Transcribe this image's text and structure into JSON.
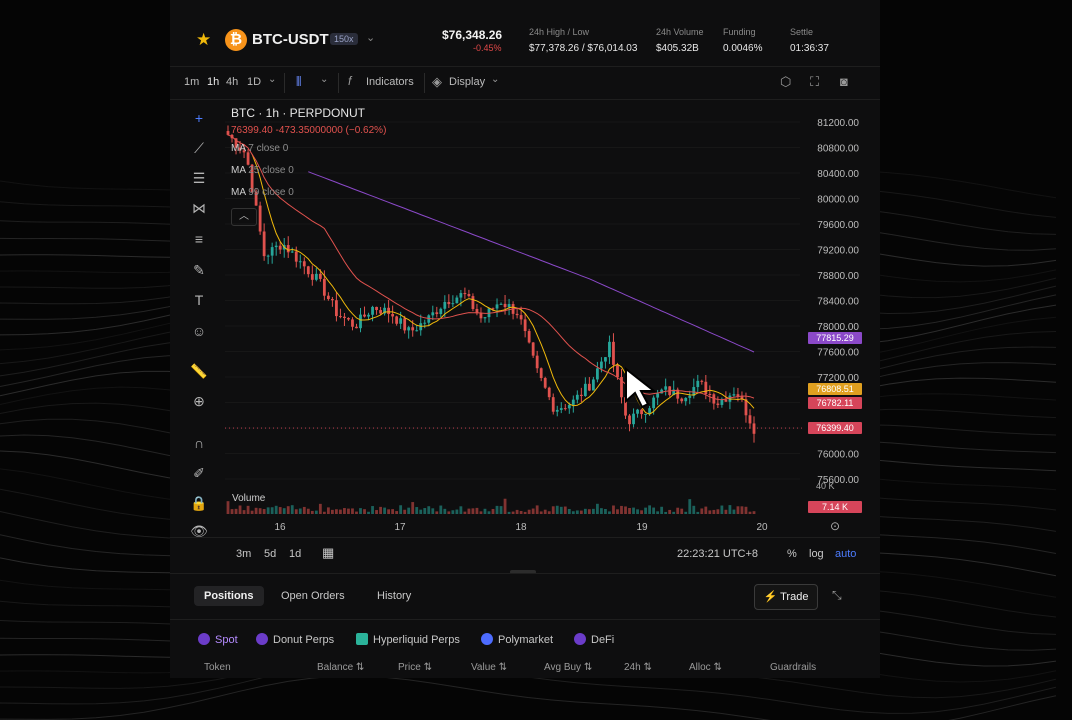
{
  "header": {
    "pair": "BTC-USDT",
    "coin_symbol": "₿",
    "leverage": "150x",
    "last_price": "$76,348.26",
    "change": "-0.45%",
    "stats": [
      {
        "label": "24h High / Low",
        "value": "$77,378.26 / $76,014.03"
      },
      {
        "label": "24h Volume",
        "value": "$405.32B"
      },
      {
        "label": "Funding",
        "value": "0.0046%"
      },
      {
        "label": "Settle",
        "value": "01:36:37"
      }
    ]
  },
  "toolbar": {
    "intervals": [
      "1m",
      "1h",
      "4h",
      "1D"
    ],
    "active_interval": "1h",
    "indicators_label": "Indicators",
    "display_label": "Display",
    "icons": [
      "candle-type-icon",
      "settings-icon",
      "fullscreen-icon",
      "camera-icon"
    ]
  },
  "chart": {
    "legend_title": "BTC · 1h · PERPDONUT",
    "legend_values": "76399.40  -473.35000000 (−0.62%)",
    "ma_lines": [
      {
        "name": "MA",
        "params": "7 close 0",
        "color": "#f0b90b"
      },
      {
        "name": "MA",
        "params": "25 close 0",
        "color": "#e0524e"
      },
      {
        "name": "MA",
        "params": "99 close 0",
        "color": "#8b49c9"
      }
    ],
    "volume_label": "Volume",
    "y_ticks": [
      "81200.00",
      "80800.00",
      "80400.00",
      "80000.00",
      "79600.00",
      "79200.00",
      "78800.00",
      "78400.00",
      "78000.00",
      "77600.00",
      "77200.00",
      "76800.00",
      "76400.00",
      "76000.00",
      "75600.00"
    ],
    "price_tags": [
      {
        "value": "77815.29",
        "color": "#8b49c9"
      },
      {
        "value": "76808.51",
        "color": "#e0a020"
      },
      {
        "value": "76782.11",
        "color": "#d6455a"
      },
      {
        "value": "76399.40",
        "color": "#d6455a"
      }
    ],
    "volume_max_tick": "40 K",
    "volume_tag": "7.14 K",
    "x_ticks": [
      "16",
      "17",
      "18",
      "19",
      "20"
    ]
  },
  "chart_bottom": {
    "ranges": [
      "3m",
      "5d",
      "1d"
    ],
    "time": "22:23:21 UTC+8",
    "percent_label": "%",
    "log_label": "log",
    "auto_label": "auto"
  },
  "positions": {
    "tabs": [
      "Positions",
      "Open Orders",
      "History"
    ],
    "trade_label": "Trade",
    "subtabs": [
      "Spot",
      "Donut Perps",
      "Hyperliquid Perps",
      "Polymarket",
      "DeFi"
    ],
    "columns": [
      "Token",
      "Balance",
      "Price",
      "Value",
      "Avg Buy",
      "24h",
      "Alloc",
      "Guardrails"
    ]
  },
  "colors": {
    "accent": "#f0b90b",
    "down": "#e0524e",
    "up": "#26a69a",
    "ma99": "#8b49c9"
  },
  "chart_data": {
    "type": "candlestick",
    "x_ticks": [
      "16",
      "17",
      "18",
      "19",
      "20"
    ],
    "y_ticks": [
      81200,
      80800,
      80400,
      80000,
      79600,
      79200,
      78800,
      78400,
      78000,
      77600,
      77200,
      76800,
      76400,
      76000,
      75600
    ],
    "ylim": [
      75600,
      81200
    ],
    "close_path_sample": [
      81000,
      80700,
      79100,
      79300,
      79000,
      78700,
      78200,
      78000,
      78300,
      78200,
      77900,
      78100,
      78400,
      78500,
      78100,
      78400,
      78200,
      77300,
      76700,
      76800,
      77100,
      77700,
      76500,
      76700,
      77000,
      76900,
      77100,
      76800,
      77000,
      76399
    ]
  }
}
